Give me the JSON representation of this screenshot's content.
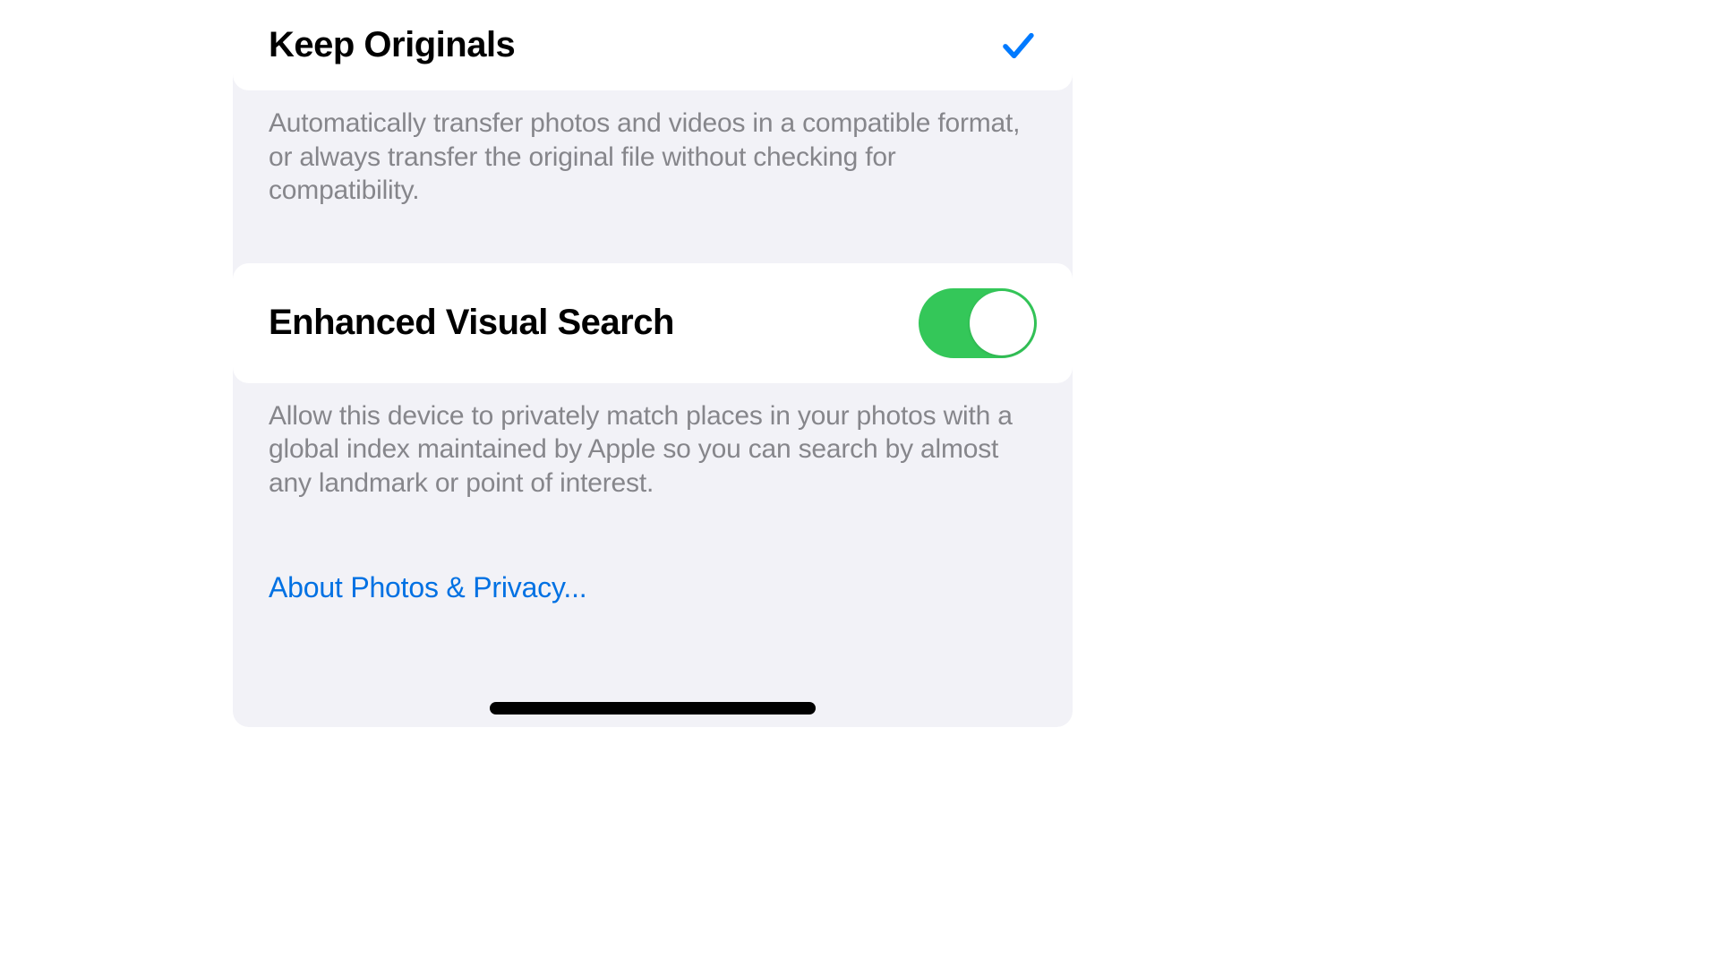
{
  "settings": {
    "keepOriginals": {
      "label": "Keep Originals",
      "selected": true,
      "footer": "Automatically transfer photos and videos in a compatible format, or always transfer the original file without checking for compatibility."
    },
    "enhancedVisualSearch": {
      "label": "Enhanced Visual Search",
      "enabled": true,
      "footer": "Allow this device to privately match places in your photos with a global index maintained by Apple so you can search by almost any landmark or point of interest."
    },
    "privacyLink": "About Photos & Privacy..."
  },
  "colors": {
    "accentBlue": "#007aff",
    "toggleGreen": "#34c759",
    "linkBlue": "#0071e3",
    "panelBg": "#f2f2f7",
    "footerGray": "#86868b"
  }
}
